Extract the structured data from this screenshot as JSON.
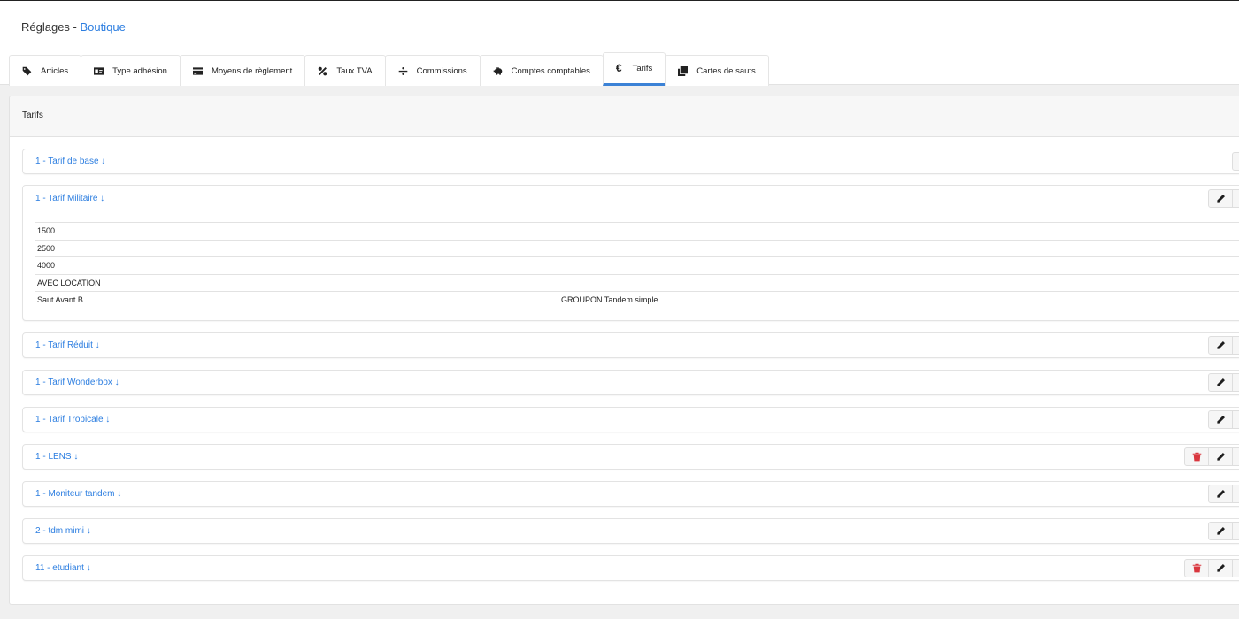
{
  "header": {
    "title": "Réglages",
    "separator": " - ",
    "section": "Boutique"
  },
  "tabs": [
    {
      "label": "Articles",
      "icon": "tags-icon"
    },
    {
      "label": "Type adhésion",
      "icon": "id-card-icon"
    },
    {
      "label": "Moyens de règlement",
      "icon": "credit-card-icon"
    },
    {
      "label": "Taux TVA",
      "icon": "percent-icon"
    },
    {
      "label": "Commissions",
      "icon": "divide-icon"
    },
    {
      "label": "Comptes comptables",
      "icon": "piggy-bank-icon"
    },
    {
      "label": "Tarifs",
      "icon": "euro-icon",
      "active": true
    },
    {
      "label": "Cartes de sauts",
      "icon": "clone-icon"
    }
  ],
  "tarifs_tab_symbol": "€",
  "panel": {
    "title": "Tarifs"
  },
  "tarifs": [
    {
      "label": "1 - Tarif de base ↓",
      "actions": [
        "plane"
      ]
    },
    {
      "label": "1 - Tarif Militaire ↓",
      "actions": [
        "edit",
        "plane"
      ],
      "expanded": true,
      "rows": [
        [
          "1500",
          ""
        ],
        [
          "2500",
          ""
        ],
        [
          "4000",
          ""
        ],
        [
          "AVEC LOCATION",
          ""
        ],
        [
          "Saut Avant B",
          "GROUPON Tandem simple"
        ]
      ]
    },
    {
      "label": "1 - Tarif Réduit ↓",
      "actions": [
        "edit",
        "plane"
      ]
    },
    {
      "label": "1 - Tarif Wonderbox ↓",
      "actions": [
        "edit",
        "plane"
      ]
    },
    {
      "label": "1 - Tarif Tropicale ↓",
      "actions": [
        "edit",
        "plane"
      ]
    },
    {
      "label": "1 - LENS ↓",
      "actions": [
        "delete",
        "edit",
        "plane"
      ]
    },
    {
      "label": "1 - Moniteur tandem ↓",
      "actions": [
        "edit",
        "plane"
      ]
    },
    {
      "label": "2 - tdm mimi ↓",
      "actions": [
        "edit",
        "plane"
      ]
    },
    {
      "label": "11 - etudiant ↓",
      "actions": [
        "delete",
        "edit",
        "plane"
      ]
    }
  ],
  "colors": {
    "link": "#2b7de0",
    "active_tab_underline": "#3b82d6",
    "delete": "#d9363e"
  }
}
